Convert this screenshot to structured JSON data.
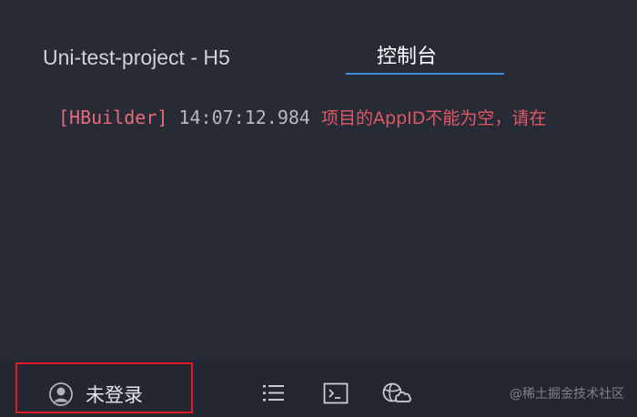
{
  "tabs": {
    "project_label": "Uni-test-project - H5",
    "console_label": "控制台",
    "active": "console"
  },
  "console": {
    "log": {
      "tag": "[HBuilder]",
      "time": "14:07:12.984",
      "message": "项目的AppID不能为空，请在"
    }
  },
  "statusbar": {
    "login_label": "未登录",
    "icons": [
      "user-avatar-icon",
      "list-icon",
      "terminal-icon",
      "cloud-globe-icon"
    ],
    "highlight_color": "#e01c22"
  },
  "watermark": "@稀土掘金技术社区",
  "colors": {
    "background": "#272b36",
    "statusbar": "#232731",
    "accent_underline": "#3e8ede",
    "error_text": "#e05865"
  }
}
